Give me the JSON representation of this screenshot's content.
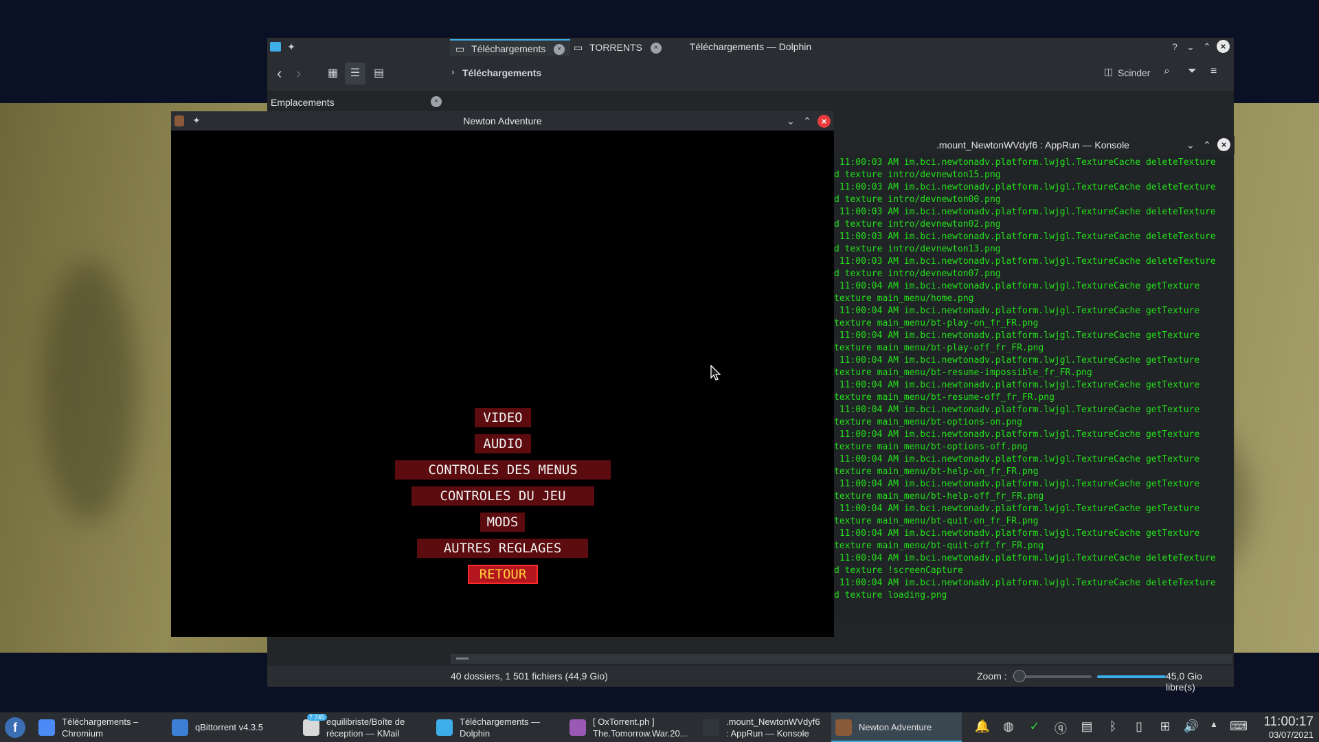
{
  "dolphin": {
    "title": "Téléchargements — Dolphin",
    "breadcrumb": "Téléchargements",
    "split_label": "Scinder",
    "places_panel": "Emplacements",
    "tabs": [
      "Téléchargements",
      "TORRENTS"
    ],
    "status": "40 dossiers, 1 501 fichiers (44,9 Gio)",
    "zoom_label": "Zoom :",
    "free_space": "45,0 Gio libre(s)"
  },
  "konsole": {
    "title": ".mount_NewtonWVdyf6 : AppRun — Konsole",
    "lines": [
      " 11:00:03 AM im.bci.newtonadv.platform.lwjgl.TextureCache deleteTexture",
      "d texture intro/devnewton15.png",
      " 11:00:03 AM im.bci.newtonadv.platform.lwjgl.TextureCache deleteTexture",
      "d texture intro/devnewton00.png",
      " 11:00:03 AM im.bci.newtonadv.platform.lwjgl.TextureCache deleteTexture",
      "d texture intro/devnewton02.png",
      " 11:00:03 AM im.bci.newtonadv.platform.lwjgl.TextureCache deleteTexture",
      "d texture intro/devnewton13.png",
      " 11:00:03 AM im.bci.newtonadv.platform.lwjgl.TextureCache deleteTexture",
      "d texture intro/devnewton07.png",
      " 11:00:04 AM im.bci.newtonadv.platform.lwjgl.TextureCache getTexture",
      "texture main_menu/home.png",
      " 11:00:04 AM im.bci.newtonadv.platform.lwjgl.TextureCache getTexture",
      "texture main_menu/bt-play-on_fr_FR.png",
      " 11:00:04 AM im.bci.newtonadv.platform.lwjgl.TextureCache getTexture",
      "texture main_menu/bt-play-off_fr_FR.png",
      " 11:00:04 AM im.bci.newtonadv.platform.lwjgl.TextureCache getTexture",
      "texture main_menu/bt-resume-impossible_fr_FR.png",
      " 11:00:04 AM im.bci.newtonadv.platform.lwjgl.TextureCache getTexture",
      "texture main_menu/bt-resume-off_fr_FR.png",
      " 11:00:04 AM im.bci.newtonadv.platform.lwjgl.TextureCache getTexture",
      "texture main_menu/bt-options-on.png",
      " 11:00:04 AM im.bci.newtonadv.platform.lwjgl.TextureCache getTexture",
      "texture main_menu/bt-options-off.png",
      " 11:00:04 AM im.bci.newtonadv.platform.lwjgl.TextureCache getTexture",
      "texture main_menu/bt-help-on_fr_FR.png",
      " 11:00:04 AM im.bci.newtonadv.platform.lwjgl.TextureCache getTexture",
      "texture main_menu/bt-help-off_fr_FR.png",
      " 11:00:04 AM im.bci.newtonadv.platform.lwjgl.TextureCache getTexture",
      "texture main_menu/bt-quit-on_fr_FR.png",
      " 11:00:04 AM im.bci.newtonadv.platform.lwjgl.TextureCache getTexture",
      "texture main_menu/bt-quit-off_fr_FR.png",
      " 11:00:04 AM im.bci.newtonadv.platform.lwjgl.TextureCache deleteTexture",
      "d texture !screenCapture",
      " 11:00:04 AM im.bci.newtonadv.platform.lwjgl.TextureCache deleteTexture",
      "d texture loading.png"
    ]
  },
  "newton": {
    "title": "Newton Adventure",
    "menu": [
      "VIDEO",
      "AUDIO",
      "CONTROLES DES MENUS",
      "CONTROLES DU JEU",
      "MODS",
      "AUTRES REGLAGES",
      "RETOUR"
    ],
    "selected": "RETOUR"
  },
  "taskbar": {
    "tasks": [
      {
        "l1": "Téléchargements –",
        "l2": "Chromium",
        "icon": "chromium-icon",
        "color": "#4c8bf5"
      },
      {
        "l1": "qBittorrent v4.3.5",
        "l2": "",
        "icon": "qbittorrent-icon",
        "color": "#3d7fd6"
      },
      {
        "l1": "equilibriste/Boîte de",
        "l2": "réception — KMail",
        "icon": "kmail-icon",
        "color": "#d9d9d9"
      },
      {
        "l1": "Téléchargements —",
        "l2": "Dolphin",
        "icon": "dolphin-icon",
        "color": "#3daee9"
      },
      {
        "l1": "[ OxTorrent.ph ]",
        "l2": "The.Tomorrow.War.20...",
        "icon": "media-player-icon",
        "color": "#9b59b6"
      },
      {
        "l1": ".mount_NewtonWVdyf6",
        "l2": ": AppRun — Konsole",
        "icon": "konsole-icon",
        "color": "#31363b"
      },
      {
        "l1": "Newton Adventure",
        "l2": "",
        "icon": "newton-icon",
        "color": "#8a5a3a"
      }
    ],
    "kmail_badge": "7 745",
    "time": "11:00:17",
    "date": "03/07/2021"
  }
}
